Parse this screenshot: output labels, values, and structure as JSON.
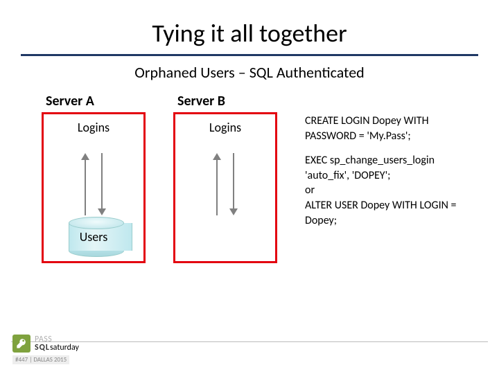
{
  "title": "Tying it all together",
  "subtitle": "Orphaned Users – SQL Authenticated",
  "serverA": {
    "label": "Server A",
    "logins": "Logins",
    "users": "Users"
  },
  "serverB": {
    "label": "Server B",
    "logins": "Logins"
  },
  "code": {
    "line1": "CREATE LOGIN Dopey WITH PASSWORD = 'My.Pass';",
    "line2": "EXEC sp_change_users_login 'auto_fix', 'DOPEY';\n                           or\nALTER USER Dopey WITH LOGIN = Dopey;"
  },
  "footer": {
    "logoTop": "PASS",
    "logoText": "SQL",
    "logoBottom": "saturday",
    "event": "#447 | DALLAS 2015"
  }
}
